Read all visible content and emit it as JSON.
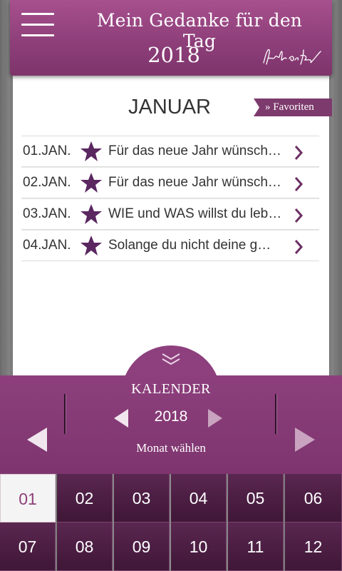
{
  "header": {
    "title": "Mein Gedanke für den Tag",
    "year": "2018",
    "menu_icon": "hamburger-menu-icon",
    "signature_icon": "signature-icon"
  },
  "main": {
    "month_title": "JANUAR",
    "favorites_label": "» Favoriten",
    "entries": [
      {
        "date": "01.JAN.",
        "text": "Für das neue Jahr wünsch…"
      },
      {
        "date": "02.JAN.",
        "text": "Für das neue Jahr wünsch…"
      },
      {
        "date": "03.JAN.",
        "text": "WIE und WAS willst du leb…"
      },
      {
        "date": "04.JAN.",
        "text": "Solange du nicht deine g…"
      }
    ]
  },
  "calendar": {
    "label": "KALENDER",
    "year": "2018",
    "month_select_label": "Monat wählen",
    "months": [
      "01",
      "02",
      "03",
      "04",
      "05",
      "06",
      "07",
      "08",
      "09",
      "10",
      "11",
      "12"
    ],
    "selected_month": "01"
  },
  "colors": {
    "accent": "#8e3f7a",
    "star": "#5a2760",
    "grid_cell": "#4e1f45",
    "active_cell_bg": "#f4f4f4"
  }
}
